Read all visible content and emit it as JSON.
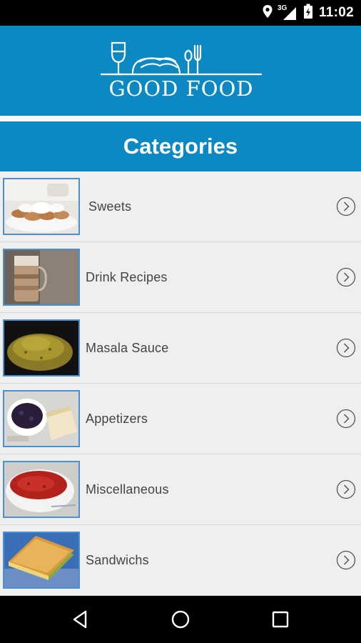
{
  "status_bar": {
    "time": "11:02",
    "network": "3G",
    "icons": [
      "location-icon",
      "signal-icon",
      "battery-icon"
    ]
  },
  "header": {
    "logo_text": "GOOD FOOD"
  },
  "section": {
    "title": "Categories"
  },
  "categories": [
    {
      "label": "Sweets",
      "thumbnail": "sweets"
    },
    {
      "label": "Drink Recipes",
      "thumbnail": "drink"
    },
    {
      "label": "Masala Sauce",
      "thumbnail": "masala"
    },
    {
      "label": "Appetizers",
      "thumbnail": "appetizers"
    },
    {
      "label": "Miscellaneous",
      "thumbnail": "soup"
    },
    {
      "label": "Sandwichs",
      "thumbnail": "sandwich"
    }
  ],
  "navigation": {
    "buttons": [
      "back-icon",
      "home-icon",
      "recents-icon"
    ]
  },
  "colors": {
    "primary": "#0c88c2",
    "thumbnail_border": "#4a8fd0",
    "list_background": "#efefef"
  }
}
